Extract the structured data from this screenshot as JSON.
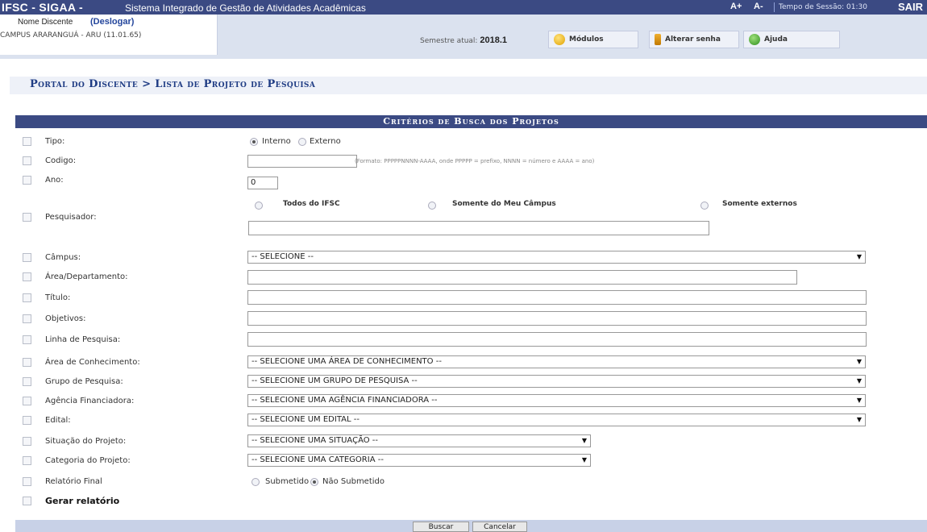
{
  "top_bar": {
    "system": "IFSC - SIGAA -",
    "system_name": "Sistema Integrado de Gestão de Atividades Acadêmicas",
    "font_increase": "A+",
    "font_decrease": "A-",
    "session_time": "Tempo de Sessão: 01:30",
    "logout": "SAIR"
  },
  "user": {
    "name": "Nome Discente",
    "logout_link": "(Deslogar)",
    "campus": "CAMPUS ARARANGUÁ - ARU (11.01.65)"
  },
  "semester": {
    "label": "Semestre atual:",
    "value": "2018.1"
  },
  "buttons": {
    "modules": "Módulos",
    "change_password": "Alterar senha",
    "help": "Ajuda"
  },
  "breadcrumb": "Portal do Discente > Lista de Projeto de Pesquisa",
  "form": {
    "title": "Critérios de Busca dos Projetos",
    "tipo": {
      "label": "Tipo:",
      "options": [
        "Interno",
        "Externo"
      ],
      "selected": "Interno"
    },
    "codigo": {
      "label": "Codigo:",
      "value": "",
      "hint": "(Formato: PPPPPNNNN-AAAA, onde PPPPP = prefixo, NNNN = número e AAAA = ano)"
    },
    "ano": {
      "label": "Ano:",
      "value": "0"
    },
    "pesquisador": {
      "label": "Pesquisador:",
      "options": [
        "Todos do IFSC",
        "Somente do Meu Câmpus",
        "Somente externos"
      ],
      "value": ""
    },
    "campus": {
      "label": "Câmpus:",
      "value": "-- SELECIONE --"
    },
    "area_departamento": {
      "label": "Área/Departamento:",
      "value": ""
    },
    "titulo": {
      "label": "Título:",
      "value": ""
    },
    "objetivos": {
      "label": "Objetivos:",
      "value": ""
    },
    "linha_pesquisa": {
      "label": "Linha de Pesquisa:",
      "value": ""
    },
    "area_conhecimento": {
      "label": "Área de Conhecimento:",
      "value": "-- SELECIONE UMA ÁREA DE CONHECIMENTO --"
    },
    "grupo_pesquisa": {
      "label": "Grupo de Pesquisa:",
      "value": "-- SELECIONE UM GRUPO DE PESQUISA --"
    },
    "agencia_financiadora": {
      "label": "Agência Financiadora:",
      "value": "-- SELECIONE UMA AGÊNCIA FINANCIADORA --"
    },
    "edital": {
      "label": "Edital:",
      "value": "-- SELECIONE UM EDITAL --"
    },
    "situacao": {
      "label": "Situação do Projeto:",
      "value": "-- SELECIONE UMA SITUAÇÃO --"
    },
    "categoria": {
      "label": "Categoria do Projeto:",
      "value": "-- SELECIONE UMA CATEGORIA --"
    },
    "relatorio_final": {
      "label": "Relatório Final",
      "options": [
        "Submetido",
        "Não Submetido"
      ],
      "selected": "Não Submetido"
    },
    "gerar_relatorio": {
      "label": "Gerar relatório"
    }
  },
  "actions": {
    "search": "Buscar",
    "cancel": "Cancelar"
  },
  "colors": {
    "header_bg": "#3b4a83",
    "info_bg": "#dbe2ef",
    "breadcrumb_text": "#1f3c84"
  },
  "icons": {
    "modules": "modules-icon",
    "password": "key-icon",
    "help": "help-icon"
  }
}
